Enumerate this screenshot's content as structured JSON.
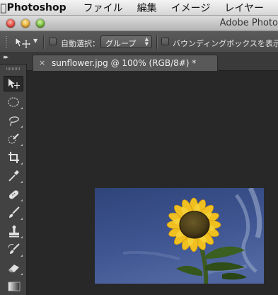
{
  "menubar": {
    "apple_icon": "apple-icon",
    "app_name": "Photoshop",
    "items": [
      "ファイル",
      "編集",
      "イメージ",
      "レイヤー"
    ]
  },
  "window": {
    "title": "Adobe Photo"
  },
  "options_bar": {
    "tool_icon": "move-tool-icon",
    "auto_select_label": "自動選択：",
    "auto_select_checked": false,
    "auto_select_target": "グループ",
    "bounding_box_label": "バウンディングボックスを表示",
    "bounding_box_checked": false
  },
  "tools_panel": {
    "collapse_glyph": "▸▸",
    "tools": [
      {
        "name": "move-tool",
        "icon": "move-icon",
        "active": true
      },
      {
        "name": "elliptical-marquee-tool",
        "icon": "ellipse-marquee-icon",
        "active": false
      },
      {
        "name": "lasso-tool",
        "icon": "lasso-icon",
        "active": false
      },
      {
        "name": "quick-selection-tool",
        "icon": "quick-selection-icon",
        "active": false
      },
      {
        "name": "crop-tool",
        "icon": "crop-icon",
        "active": false
      },
      {
        "name": "eyedropper-tool",
        "icon": "eyedropper-icon",
        "active": false
      },
      {
        "name": "spot-healing-brush-tool",
        "icon": "bandage-icon",
        "active": false
      },
      {
        "name": "brush-tool",
        "icon": "brush-icon",
        "active": false
      },
      {
        "name": "clone-stamp-tool",
        "icon": "stamp-icon",
        "active": false
      },
      {
        "name": "history-brush-tool",
        "icon": "history-brush-icon",
        "active": false
      },
      {
        "name": "eraser-tool",
        "icon": "eraser-icon",
        "active": false
      },
      {
        "name": "gradient-tool",
        "icon": "gradient-icon",
        "active": false
      }
    ]
  },
  "document": {
    "tab_title": "sunflower.jpg @ 100% (RGB/8#) *",
    "close_glyph": "×"
  },
  "colors": {
    "workspace_bg": "#282828",
    "panel_bg": "#424242",
    "options_bar_bg": "#505050",
    "sky": "#3c5390",
    "petal": "#f0c020"
  }
}
